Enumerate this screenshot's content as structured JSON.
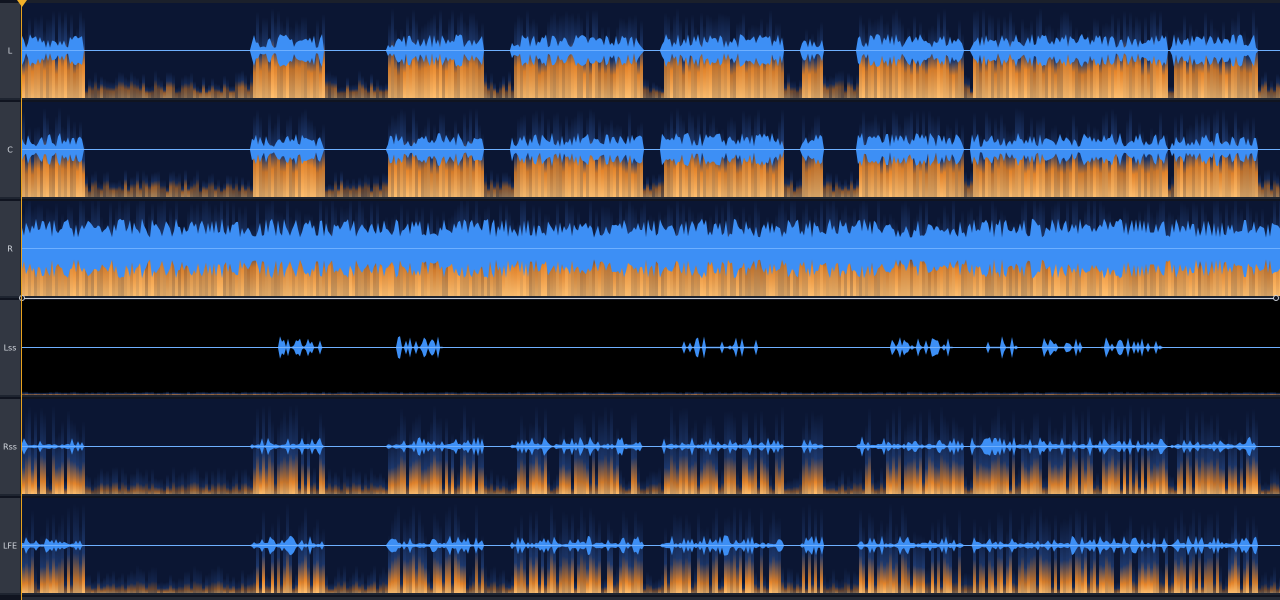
{
  "channels": [
    {
      "label": "L",
      "profile": "dense",
      "spec": "bright",
      "wave": 0.55
    },
    {
      "label": "C",
      "profile": "dense",
      "spec": "bright",
      "wave": 0.55
    },
    {
      "label": "R",
      "profile": "full",
      "spec": "bright",
      "wave": 0.85
    },
    {
      "label": "Lss",
      "profile": "sparse",
      "spec": "dark",
      "wave": 0.45
    },
    {
      "label": "Rss",
      "profile": "medium",
      "spec": "dim",
      "wave": 0.45
    },
    {
      "label": "LFE",
      "profile": "medium",
      "spec": "dim",
      "wave": 0.45
    }
  ],
  "colors": {
    "waveform": "#3d8ff5",
    "waveform_center": "#6fb0ff",
    "spec_dark": "#0b1633",
    "spec_mid": "#1e3a70",
    "spec_orange": "#e8862a",
    "spec_hot": "#ffc070",
    "playhead": "#e8a21f"
  },
  "icons": {
    "playhead": "playhead-marker-icon"
  }
}
